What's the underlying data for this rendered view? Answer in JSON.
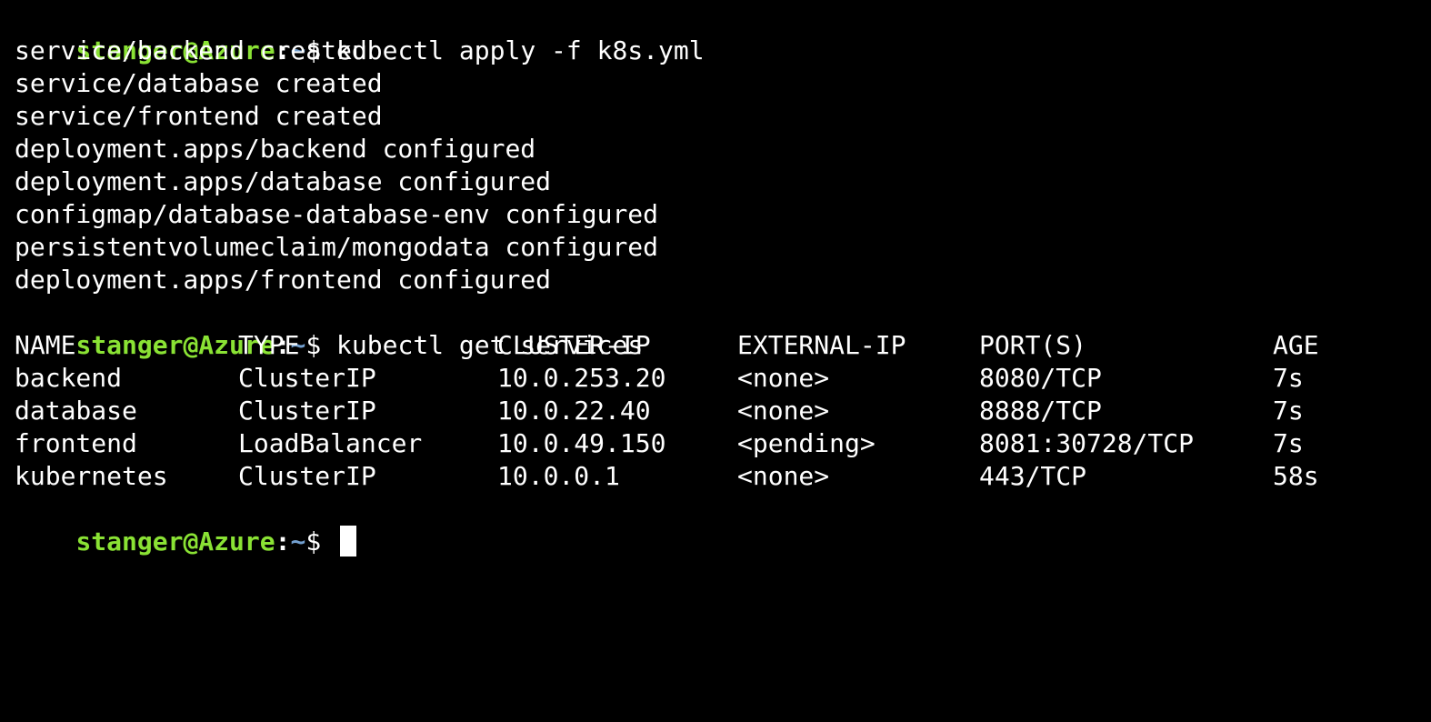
{
  "prompt": {
    "user_host": "stanger@Azure",
    "separator": ":",
    "path": "~",
    "dollar": "$"
  },
  "commands": {
    "apply": "kubectl apply -f k8s.yml",
    "get_services": "kubectl get services"
  },
  "apply_output": [
    "service/backend created",
    "service/database created",
    "service/frontend created",
    "deployment.apps/backend configured",
    "deployment.apps/database configured",
    "configmap/database-database-env configured",
    "persistentvolumeclaim/mongodata configured",
    "deployment.apps/frontend configured"
  ],
  "services_table": {
    "headers": [
      "NAME",
      "TYPE",
      "CLUSTER-IP",
      "EXTERNAL-IP",
      "PORT(S)",
      "AGE"
    ],
    "rows": [
      [
        "backend",
        "ClusterIP",
        "10.0.253.20",
        "<none>",
        "8080/TCP",
        "7s"
      ],
      [
        "database",
        "ClusterIP",
        "10.0.22.40",
        "<none>",
        "8888/TCP",
        "7s"
      ],
      [
        "frontend",
        "LoadBalancer",
        "10.0.49.150",
        "<pending>",
        "8081:30728/TCP",
        "7s"
      ],
      [
        "kubernetes",
        "ClusterIP",
        "10.0.0.1",
        "<none>",
        "443/TCP",
        "58s"
      ]
    ]
  },
  "colors": {
    "background": "#000000",
    "prompt_user": "#8ae234",
    "prompt_path": "#729fcf",
    "text": "#ffffff"
  }
}
